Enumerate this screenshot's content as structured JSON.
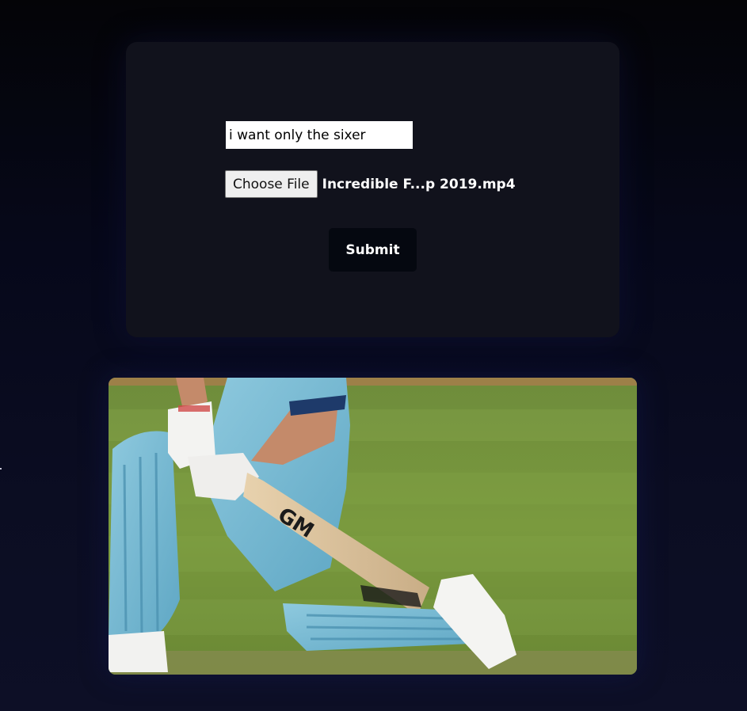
{
  "form": {
    "prompt_value": "i want only the sixer",
    "choose_file_label": "Choose File",
    "file_name": "Incredible F...p 2019.mp4",
    "submit_label": "Submit"
  },
  "video": {
    "bat_brand": "GM"
  }
}
